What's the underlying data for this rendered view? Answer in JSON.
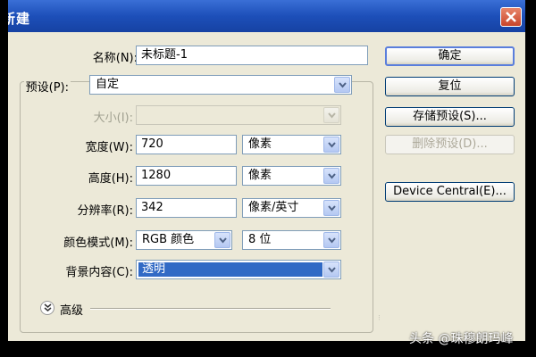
{
  "window": {
    "title": "新建",
    "close_icon": "close-icon"
  },
  "form": {
    "name": {
      "label": "名称(N):",
      "value": "未标题-1"
    },
    "preset": {
      "label": "预设(P):",
      "value": "自定"
    },
    "size": {
      "label": "大小(I):",
      "value": "",
      "disabled": true
    },
    "width": {
      "label": "宽度(W):",
      "value": "720",
      "unit": "像素"
    },
    "height": {
      "label": "高度(H):",
      "value": "1280",
      "unit": "像素"
    },
    "resolution": {
      "label": "分辨率(R):",
      "value": "342",
      "unit": "像素/英寸"
    },
    "color_mode": {
      "label": "颜色模式(M):",
      "mode": "RGB 颜色",
      "depth": "8 位"
    },
    "background": {
      "label": "背景内容(C):",
      "value": "透明"
    },
    "advanced": {
      "label": "高级"
    }
  },
  "buttons": {
    "ok": "确定",
    "reset": "复位",
    "save_preset": "存储预设(S)...",
    "delete_preset": "删除预设(D)...",
    "device_central": "Device Central(E)..."
  },
  "watermark": "头条 @珠穆朗玛峰"
}
